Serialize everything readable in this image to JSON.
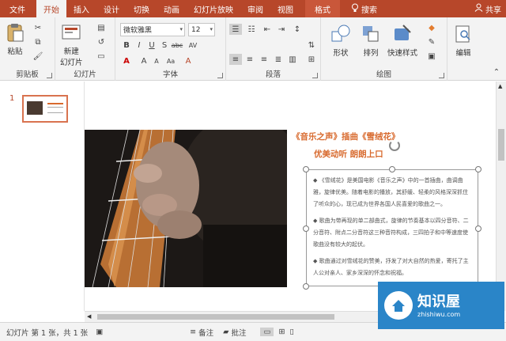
{
  "tabs": [
    "文件",
    "开始",
    "插入",
    "设计",
    "切换",
    "动画",
    "幻灯片放映",
    "审阅",
    "视图",
    "格式"
  ],
  "search_label": "搜索",
  "share_label": "共享",
  "ribbon": {
    "clipboard": {
      "label": "剪贴板",
      "paste": "粘贴"
    },
    "slides": {
      "label": "幻灯片",
      "new_line1": "新建",
      "new_line2": "幻灯片"
    },
    "font": {
      "label": "字体",
      "name": "微软雅黑",
      "size": "12"
    },
    "paragraph": {
      "label": "段落"
    },
    "drawing": {
      "label": "绘图",
      "shapes": "形状",
      "arrange": "排列",
      "quick_styles": "快速样式"
    },
    "editing": {
      "label": "编辑"
    }
  },
  "thumb_number": "1",
  "slide": {
    "title_line1": "《音乐之声》插曲《雪绒花》",
    "title_line2": "优美动听 朗朗上口",
    "bullets": [
      "《雪绒花》是美国电影《音乐之声》中的一首插曲，曲调曲雅，旋律优美。随着电影的播放，其舒缓、轻柔的风格深深抓住了听众的心，现已成为世界各国人民喜爱的歌曲之一。",
      "歌曲为带再现的单二部曲式，旋律的节奏基本以四分音符、二分音符、附点二分音符这三种音符构成，三四拍子和中等速度使歌曲没有较大的起伏。",
      "歌曲通过对雪绒花的赞美，抒发了对大自然的热爱，寄托了主人公对亲人、家乡深深的怀念和祝福。"
    ]
  },
  "status": {
    "slide_info": "幻灯片 第 1 张，共 1 张",
    "notes": "备注",
    "comments": "批注"
  },
  "watermark": {
    "name": "知识屋",
    "url": "zhishiwu.com"
  },
  "colors": {
    "accent": "#b7472a",
    "title": "#d86a2e"
  }
}
